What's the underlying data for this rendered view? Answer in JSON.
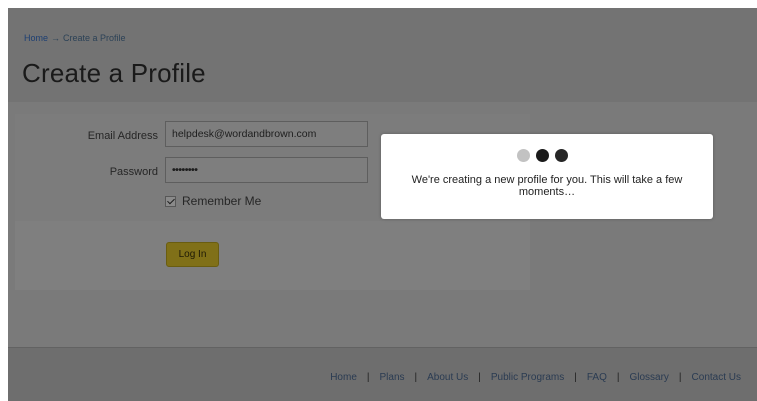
{
  "breadcrumb": {
    "home": "Home",
    "separator": "→",
    "current": "Create a Profile"
  },
  "page": {
    "title": "Create a Profile"
  },
  "form": {
    "email_label": "Email Address",
    "email_value": "helpdesk@wordandbrown.com",
    "password_label": "Password",
    "password_value": "••••••••",
    "remember_label": "Remember Me",
    "remember_checked": true,
    "login_label": "Log In"
  },
  "dialog": {
    "message": "We're creating a new profile for you. This will take a few moments…"
  },
  "footer": {
    "links": [
      "Home",
      "Plans",
      "About Us",
      "Public Programs",
      "FAQ",
      "Glossary",
      "Contact Us"
    ],
    "separator": "|"
  },
  "colors": {
    "overlay": "#767676",
    "button": "#807018",
    "dialog_bg": "#ffffff"
  }
}
